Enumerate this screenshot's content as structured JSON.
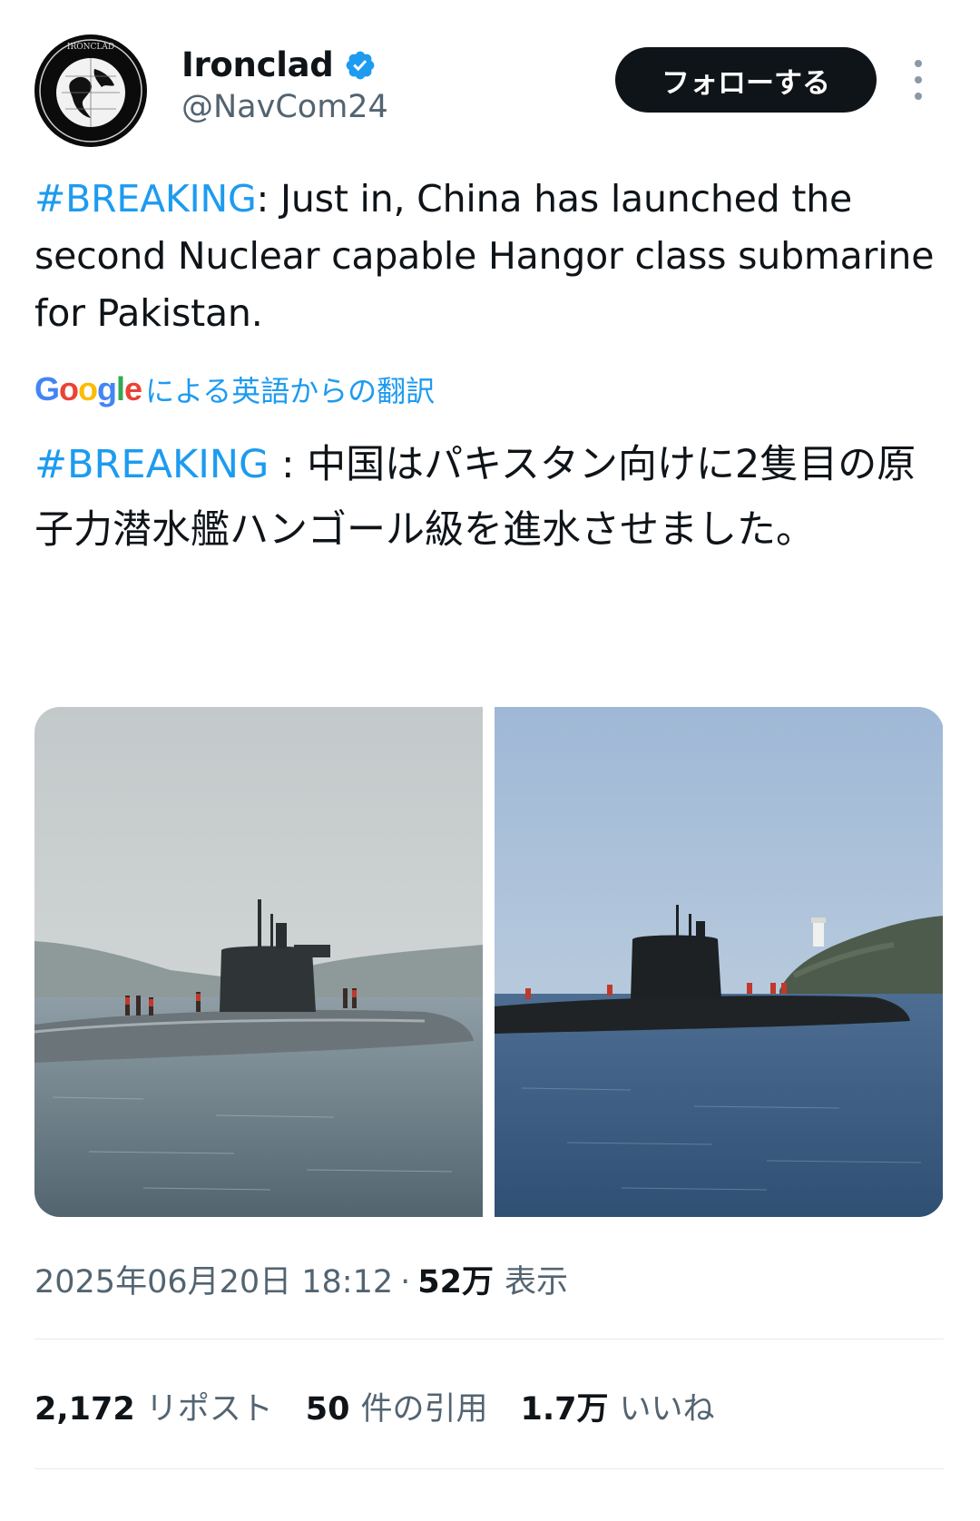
{
  "account": {
    "name": "Ironclad",
    "handle": "@NavCom24",
    "avatar_text": "IRONCLAD",
    "verified": true
  },
  "follow_button": "フォローする",
  "menu_icon": "more-vertical-icon",
  "tweet": {
    "hashtag": "#BREAKING",
    "text_en_rest": ": Just in, China has launched the second Nuclear capable Hangor class submarine for Pakistan.",
    "translate": {
      "provider": "Google",
      "label": "による英語からの翻訳"
    },
    "hashtag_ja": "#BREAKING",
    "text_ja_rest": " : 中国はパキスタン向けに2隻目の原子力潜水艦ハンゴール級を進水させました。"
  },
  "media": {
    "count": 2
  },
  "meta": {
    "timestamp": "2025年06月20日 18:12",
    "separator": "·",
    "views_count": "52万",
    "views_label": "表示"
  },
  "stats": {
    "reposts_count": "2,172",
    "reposts_label": "リポスト",
    "quotes_count": "50",
    "quotes_label": "件の引用",
    "likes_count": "1.7万",
    "likes_label": "いいね"
  },
  "colors": {
    "accent": "#1d9bf0",
    "text": "#0f1419",
    "secondary": "#536471",
    "button_bg": "#0f1419"
  }
}
